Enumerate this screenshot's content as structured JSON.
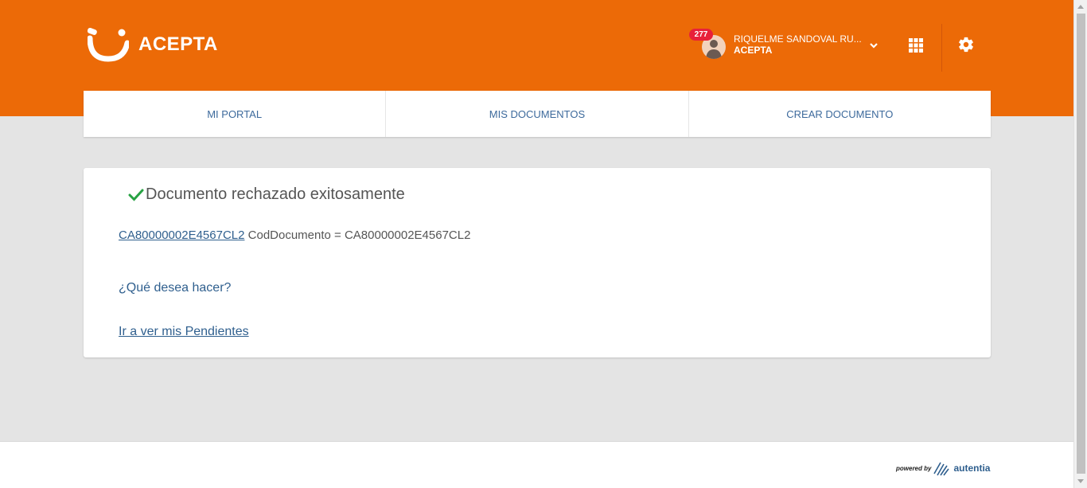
{
  "brand": {
    "name": "ACEPTA",
    "color": "#ec6a07"
  },
  "user": {
    "notifications": "277",
    "name": "RIQUELME SANDOVAL RU...",
    "org": "ACEPTA"
  },
  "icons": {
    "logo": "acepta-smile-logo",
    "avatar": "user-avatar-icon",
    "chevron": "chevron-down-icon",
    "apps": "apps-grid-icon",
    "settings": "gear-icon",
    "check": "check-icon"
  },
  "nav": {
    "items": [
      {
        "label": "MI PORTAL"
      },
      {
        "label": "MIS DOCUMENTOS"
      },
      {
        "label": "CREAR DOCUMENTO"
      }
    ]
  },
  "card": {
    "success_message": "Documento rechazado exitosamente",
    "doc_link": "CA80000002E4567CL2",
    "doc_detail": "CodDocumento = CA80000002E4567CL2",
    "question": "¿Qué desea hacer?",
    "pending_link": "Ir a ver mis Pendientes"
  },
  "footer": {
    "powered_by": "powered by",
    "provider": "autentia"
  }
}
